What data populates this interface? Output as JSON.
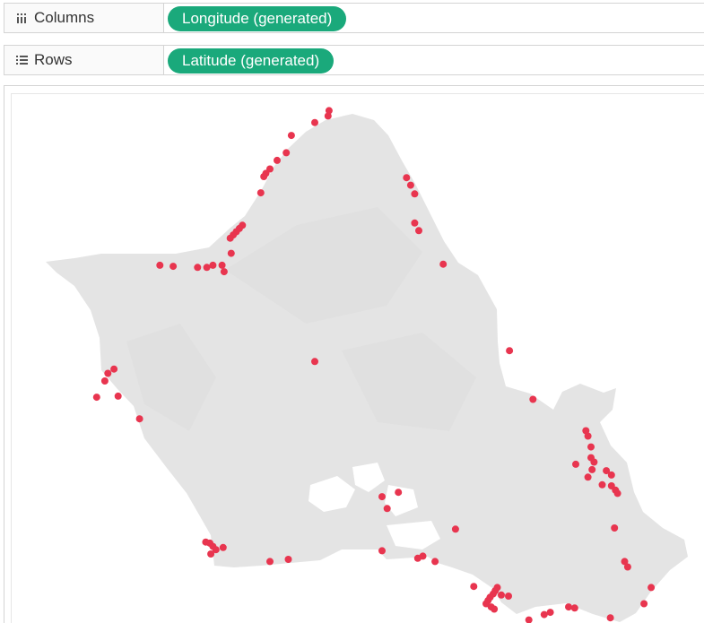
{
  "shelves": {
    "columns": {
      "label": "Columns",
      "icon": "columns-shelf-icon",
      "pill": "Longitude (generated)"
    },
    "rows": {
      "label": "Rows",
      "icon": "rows-shelf-icon",
      "pill": "Latitude (generated)"
    }
  },
  "map": {
    "island": "Oahu",
    "land_color": "#e4e4e4",
    "mark_color": "#e8354f",
    "points": [
      [
        21.712,
        -158.016
      ],
      [
        21.718,
        -158.003
      ],
      [
        21.723,
        -158.002
      ],
      [
        21.7,
        -158.039
      ],
      [
        21.684,
        -158.044
      ],
      [
        21.677,
        -158.053
      ],
      [
        21.669,
        -158.06
      ],
      [
        21.665,
        -158.064
      ],
      [
        21.662,
        -158.066
      ],
      [
        21.647,
        -158.069
      ],
      [
        21.617,
        -158.087
      ],
      [
        21.614,
        -158.09
      ],
      [
        21.611,
        -158.093
      ],
      [
        21.608,
        -158.096
      ],
      [
        21.605,
        -158.099
      ],
      [
        21.58,
        -158.168
      ],
      [
        21.579,
        -158.155
      ],
      [
        21.578,
        -158.131
      ],
      [
        21.578,
        -158.122
      ],
      [
        21.58,
        -158.116
      ],
      [
        21.58,
        -158.107
      ],
      [
        21.591,
        -158.098
      ],
      [
        21.574,
        -158.105
      ],
      [
        21.661,
        -157.926
      ],
      [
        21.654,
        -157.922
      ],
      [
        21.646,
        -157.918
      ],
      [
        21.619,
        -157.918
      ],
      [
        21.612,
        -157.914
      ],
      [
        21.581,
        -157.89
      ],
      [
        21.501,
        -157.825
      ],
      [
        21.456,
        -157.802
      ],
      [
        21.398,
        -157.742
      ],
      [
        21.396,
        -157.76
      ],
      [
        21.427,
        -157.75
      ],
      [
        21.422,
        -157.748
      ],
      [
        21.412,
        -157.745
      ],
      [
        21.402,
        -157.745
      ],
      [
        21.391,
        -157.744
      ],
      [
        21.384,
        -157.748
      ],
      [
        21.39,
        -157.73
      ],
      [
        21.386,
        -157.725
      ],
      [
        21.377,
        -157.734
      ],
      [
        21.376,
        -157.725
      ],
      [
        21.372,
        -157.721
      ],
      [
        21.369,
        -157.719
      ],
      [
        21.337,
        -157.722
      ],
      [
        21.306,
        -157.712
      ],
      [
        21.301,
        -157.709
      ],
      [
        21.254,
        -157.726
      ],
      [
        21.282,
        -157.686
      ],
      [
        21.267,
        -157.693
      ],
      [
        21.263,
        -157.761
      ],
      [
        21.264,
        -157.767
      ],
      [
        21.259,
        -157.785
      ],
      [
        21.257,
        -157.791
      ],
      [
        21.252,
        -157.806
      ],
      [
        21.241,
        -157.814
      ],
      [
        21.237,
        -157.815
      ],
      [
        21.243,
        -157.823
      ],
      [
        21.274,
        -157.826
      ],
      [
        21.282,
        -157.837
      ],
      [
        21.279,
        -157.839
      ],
      [
        21.276,
        -157.841
      ],
      [
        21.273,
        -157.844
      ],
      [
        21.27,
        -157.846
      ],
      [
        21.267,
        -157.848
      ],
      [
        21.264,
        -157.843
      ],
      [
        21.262,
        -157.84
      ],
      [
        21.275,
        -157.833
      ],
      [
        21.283,
        -157.86
      ],
      [
        21.37,
        -157.934
      ],
      [
        21.355,
        -157.945
      ],
      [
        21.366,
        -157.95
      ],
      [
        21.316,
        -157.95
      ],
      [
        21.309,
        -157.915
      ],
      [
        21.311,
        -157.91
      ],
      [
        21.306,
        -157.898
      ],
      [
        21.336,
        -157.878
      ],
      [
        21.473,
        -158.222
      ],
      [
        21.48,
        -158.219
      ],
      [
        21.484,
        -158.213
      ],
      [
        21.459,
        -158.209
      ],
      [
        21.438,
        -158.188
      ],
      [
        21.324,
        -158.123
      ],
      [
        21.323,
        -158.119
      ],
      [
        21.32,
        -158.116
      ],
      [
        21.317,
        -158.113
      ],
      [
        21.313,
        -158.118
      ],
      [
        21.319,
        -158.106
      ],
      [
        21.306,
        -158.06
      ],
      [
        21.308,
        -158.042
      ],
      [
        21.491,
        -158.016
      ],
      [
        21.458,
        -158.23
      ]
    ]
  }
}
